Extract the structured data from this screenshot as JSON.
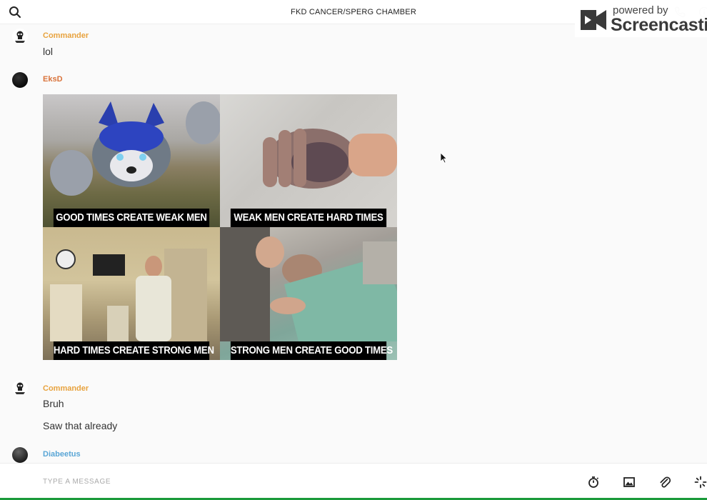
{
  "header": {
    "title": "FKD CANCER/SPERG CHAMBER"
  },
  "watermark": {
    "powered": "powered by",
    "brand": "Screencastify"
  },
  "messages": [
    {
      "author": "Commander",
      "author_color": "#e8a33f",
      "texts": [
        "lol"
      ]
    },
    {
      "author": "EksD",
      "author_color": "#d9733b",
      "image": {
        "captions": [
          "GOOD TIMES CREATE WEAK MEN",
          "WEAK MEN CREATE HARD TIMES",
          "HARD TIMES CREATE STRONG MEN",
          "STRONG MEN CREATE GOOD TIMES"
        ]
      }
    },
    {
      "author": "Commander",
      "author_color": "#e8a33f",
      "texts": [
        "Bruh",
        "Saw that already"
      ]
    },
    {
      "author": "Diabeetus",
      "author_color": "#5aa6d6",
      "texts": []
    }
  ],
  "composer": {
    "placeholder": "TYPE A MESSAGE"
  },
  "icons": {
    "search": "search-icon",
    "phone": "phone-icon",
    "info": "info-icon",
    "timer": "stopwatch-icon",
    "image": "image-icon",
    "attach": "paperclip-icon",
    "more": "sparkle-icon"
  },
  "colors": {
    "accent_green": "#1b9a3a"
  }
}
